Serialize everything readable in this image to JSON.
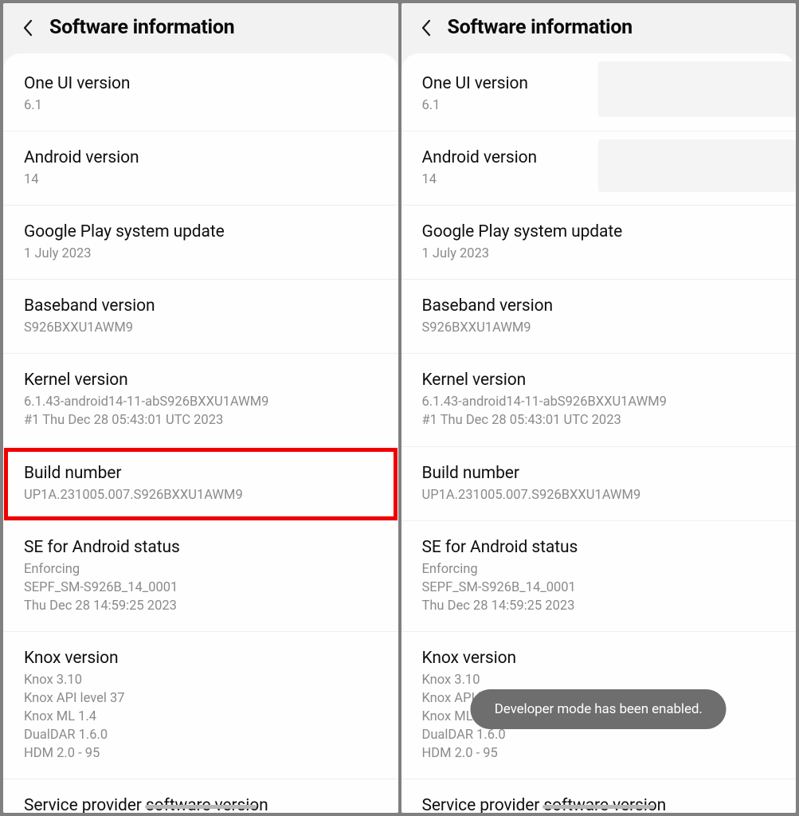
{
  "header": {
    "title": "Software information"
  },
  "items": {
    "one_ui": {
      "title": "One UI version",
      "value": "6.1"
    },
    "android": {
      "title": "Android version",
      "value": "14"
    },
    "play_update": {
      "title": "Google Play system update",
      "value": "1 July 2023"
    },
    "baseband": {
      "title": "Baseband version",
      "value": "S926BXXU1AWM9"
    },
    "kernel": {
      "title": "Kernel version",
      "value": "6.1.43-android14-11-abS926BXXU1AWM9\n#1 Thu Dec 28 05:43:01 UTC 2023"
    },
    "build": {
      "title": "Build number",
      "value": "UP1A.231005.007.S926BXXU1AWM9"
    },
    "se_android": {
      "title": "SE for Android status",
      "value": "Enforcing\nSEPF_SM-S926B_14_0001\nThu Dec 28 14:59:25 2023"
    },
    "knox": {
      "title": "Knox version",
      "value": "Knox 3.10\nKnox API level 37\nKnox ML 1.4\nDualDAR 1.6.0\nHDM 2.0 - 95"
    },
    "service_provider": {
      "title": "Service provider software version",
      "value": ""
    }
  },
  "toast": {
    "message": "Developer mode has been enabled."
  }
}
